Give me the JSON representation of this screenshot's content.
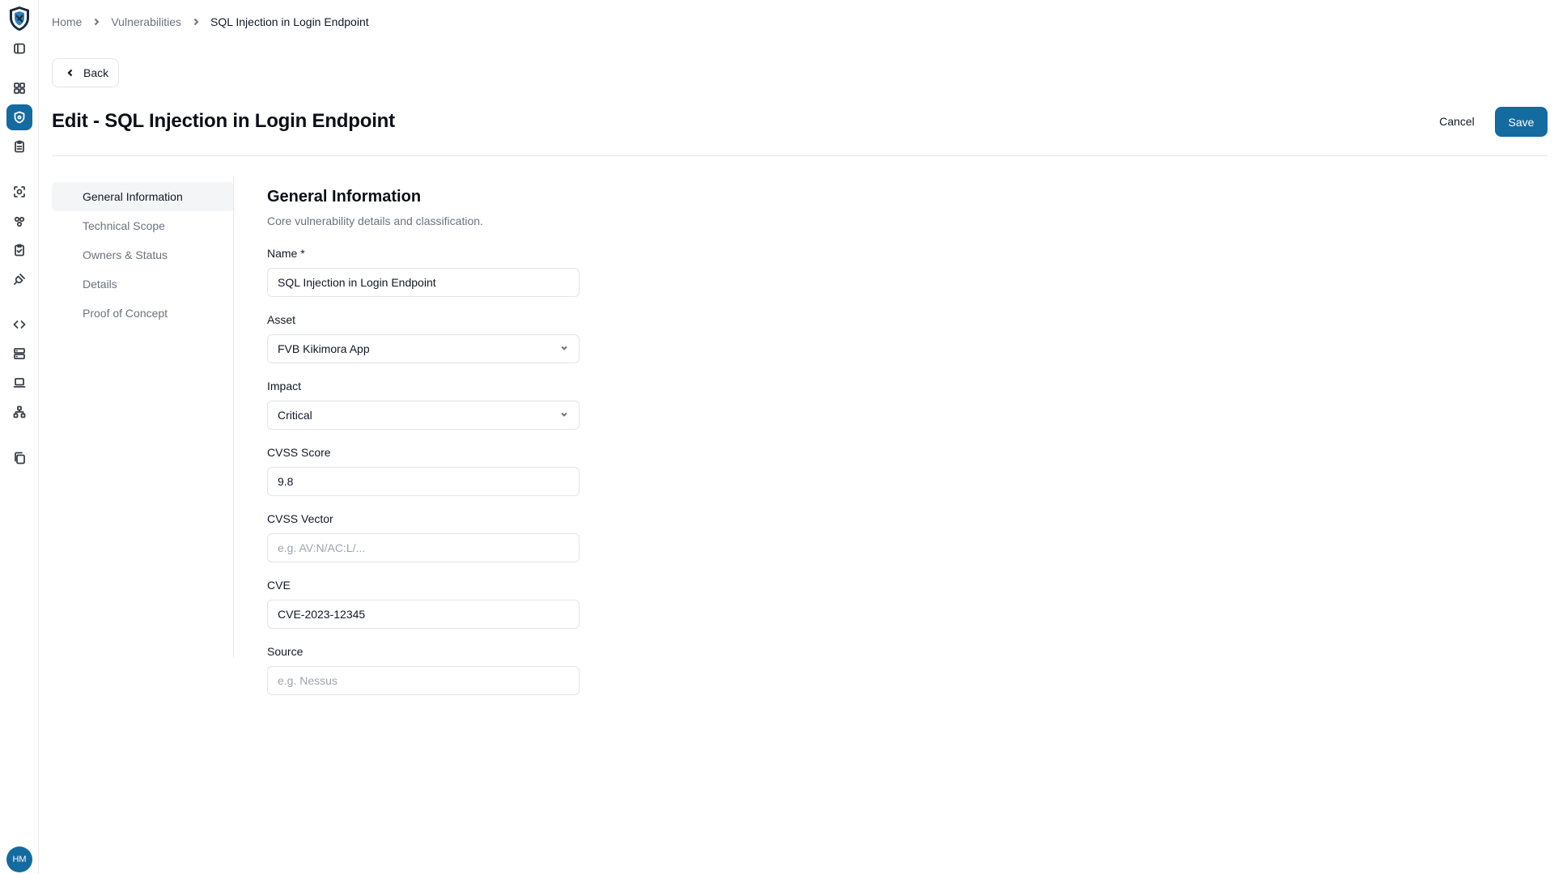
{
  "rail": {
    "icons": [
      "sidebar-toggle-icon",
      "dashboard-icon",
      "shield-icon",
      "clipboard-icon",
      "scan-icon",
      "users-icon",
      "clipboard-check-icon",
      "plug-icon",
      "code-icon",
      "server-icon",
      "laptop-icon",
      "network-icon",
      "copy-icon"
    ],
    "active": "shield-icon",
    "avatar_initials": "HM",
    "accent_color": "#136ba0"
  },
  "breadcrumb": {
    "items": [
      "Home",
      "Vulnerabilities"
    ],
    "current": "SQL Injection in Login Endpoint"
  },
  "back_label": "Back",
  "page_title": "Edit - SQL Injection in Login Endpoint",
  "actions": {
    "cancel": "Cancel",
    "save": "Save"
  },
  "section_nav": {
    "items": [
      "General Information",
      "Technical Scope",
      "Owners & Status",
      "Details",
      "Proof of Concept"
    ],
    "active_index": 0
  },
  "form": {
    "title": "General Information",
    "subtitle": "Core vulnerability details and classification.",
    "fields": {
      "name": {
        "label": "Name *",
        "value": "SQL Injection in Login Endpoint"
      },
      "asset": {
        "label": "Asset",
        "value": "FVB Kikimora App"
      },
      "impact": {
        "label": "Impact",
        "value": "Critical"
      },
      "cvss_score": {
        "label": "CVSS Score",
        "value": "9.8"
      },
      "cvss_vector": {
        "label": "CVSS Vector",
        "placeholder": "e.g. AV:N/AC:L/..."
      },
      "cve": {
        "label": "CVE",
        "value": "CVE-2023-12345"
      },
      "source": {
        "label": "Source",
        "placeholder": "e.g. Nessus"
      }
    }
  }
}
